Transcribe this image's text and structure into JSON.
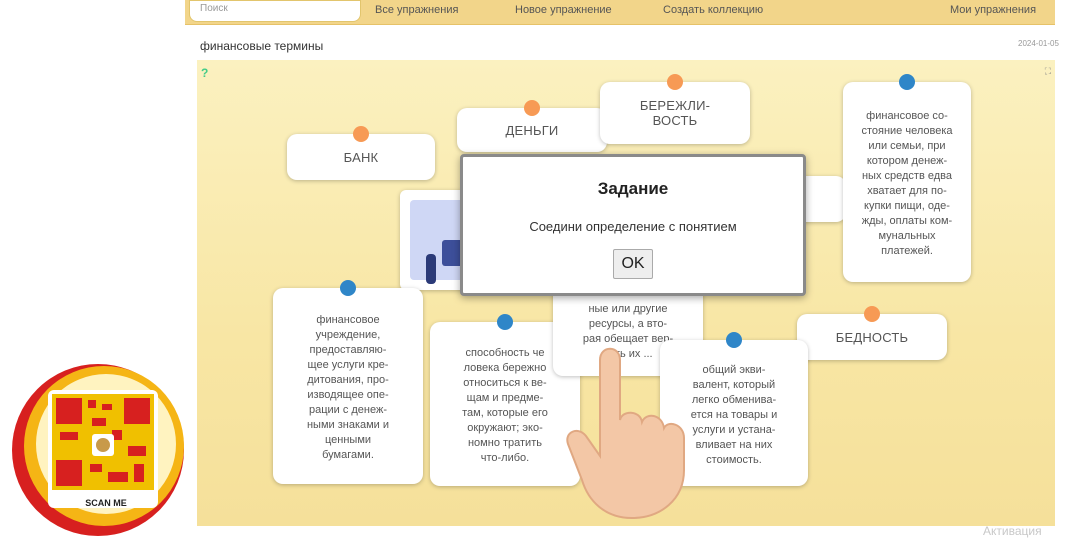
{
  "toolbar": {
    "search_value": "Поиск",
    "buttons": [
      "Все упражнения",
      "Новое упражнение",
      "Создать коллекцию",
      "Мои упражнения"
    ]
  },
  "page": {
    "title": "финансовые термины",
    "date": "2024-01-05"
  },
  "terms": {
    "bank": "БАНК",
    "money": "ДЕНЬГИ",
    "thrift": "БЕРЕЖЛИ-\nВОСТЬ",
    "poverty": "БЕДНОСТЬ"
  },
  "definitions": {
    "poverty_def": "финансовое со-\nстояние человека\nили семьи, при\nкотором денеж-\nных средств едва\nхватает для по-\nкупки пищи, оде-\nжды, оплаты ком-\nмунальных\nплатежей.",
    "bank_def": "финансовое\nучреждение,\nпредоставляю-\nщее услуги кре-\nдитования, про-\nизводящее опе-\nрации с денеж-\nными знаками и\nценными\nбумагами.",
    "thrift_def": "способность че\nловека бережно\nотноситься к ве-\nщам и предме-\nтам, которые его\nокружают; эко-\nномно тратить\nчто-либо.",
    "credit_def": "ные или другие\nресурсы, а вто-\nрая обещает вер-\nнуть их ...",
    "money_def": "общий экви-\nвалент, который\nлегко обменива-\nется на товары и\nуслуги и устана-\nвливает на них\nстоимость."
  },
  "modal": {
    "title": "Задание",
    "message": "Соедини определение с понятием",
    "ok": "OK"
  },
  "badge": {
    "label": "SCAN ME"
  },
  "watermark": "Активация",
  "colors": {
    "accent_orange": "#f79a55",
    "accent_blue": "#2f86c8",
    "toolbar": "#f2d58a"
  }
}
